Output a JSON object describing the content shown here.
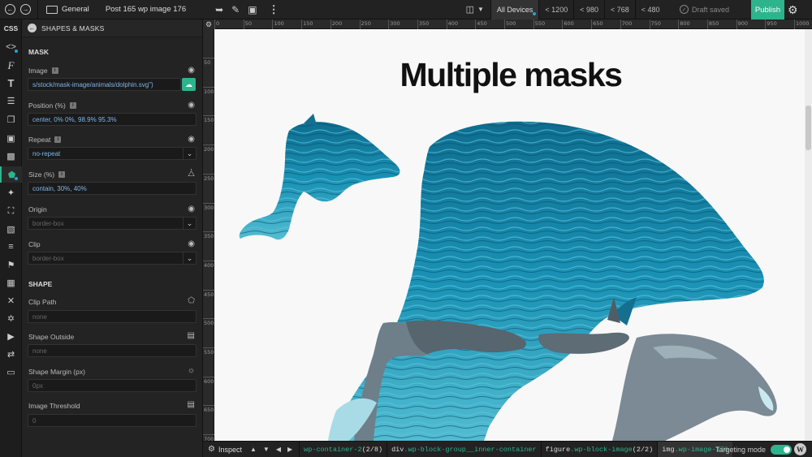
{
  "topbar": {
    "workspace": "General",
    "post_title": "Post 165 wp image 176",
    "breakpoints": [
      "All Devices",
      "< 1200",
      "< 980",
      "< 768",
      "< 480"
    ],
    "status": "Draft saved",
    "publish_label": "Publish"
  },
  "rail": {
    "css_label": "CSS"
  },
  "panel": {
    "title": "SHAPES & MASKS",
    "mask_section": "MASK",
    "shape_section": "SHAPE",
    "image": {
      "label": "Image",
      "value": "s/stock/mask-image/animals/dolphin.svg\")"
    },
    "position": {
      "label": "Position (%)",
      "value": "center, 0% 0%, 98.9% 95.3%"
    },
    "repeat": {
      "label": "Repeat",
      "value": "no-repeat"
    },
    "size": {
      "label": "Size (%)",
      "value": "contain, 30%, 40%"
    },
    "origin": {
      "label": "Origin",
      "placeholder": "border-box"
    },
    "clip": {
      "label": "Clip",
      "placeholder": "border-box"
    },
    "clip_path": {
      "label": "Clip Path",
      "placeholder": "none"
    },
    "shape_outside": {
      "label": "Shape Outside",
      "placeholder": "none"
    },
    "shape_margin": {
      "label": "Shape Margin (px)",
      "placeholder": "0px"
    },
    "image_threshold": {
      "label": "Image Threshold",
      "placeholder": "0"
    }
  },
  "ruler": {
    "top": [
      "0",
      "50",
      "100",
      "150",
      "200",
      "250",
      "300",
      "350",
      "400",
      "450",
      "500",
      "550",
      "600",
      "650",
      "700",
      "750",
      "800",
      "850",
      "900",
      "950",
      "1000"
    ],
    "left": [
      "50",
      "100",
      "150",
      "200",
      "250",
      "300",
      "350",
      "400",
      "450",
      "500",
      "550",
      "600",
      "650",
      "700"
    ]
  },
  "canvas": {
    "heading": "Multiple masks"
  },
  "bottombar": {
    "inspect_label": "Inspect",
    "crumbs": [
      {
        "tag": "",
        "cls": "wp-container-2",
        "suffix": " (2/8)"
      },
      {
        "tag": "div",
        "cls": ".wp-block-group__inner-container",
        "suffix": ""
      },
      {
        "tag": "figure",
        "cls": ".wp-block-image",
        "suffix": " (2/2)"
      },
      {
        "tag": "img",
        "cls": ".wp-image-176",
        "suffix": ""
      }
    ],
    "targeting_label": "Targeting mode"
  },
  "colors": {
    "accent": "#2db48d",
    "panel": "#232323",
    "field_text": "#7db6e8",
    "water": "#1d8fb0"
  }
}
